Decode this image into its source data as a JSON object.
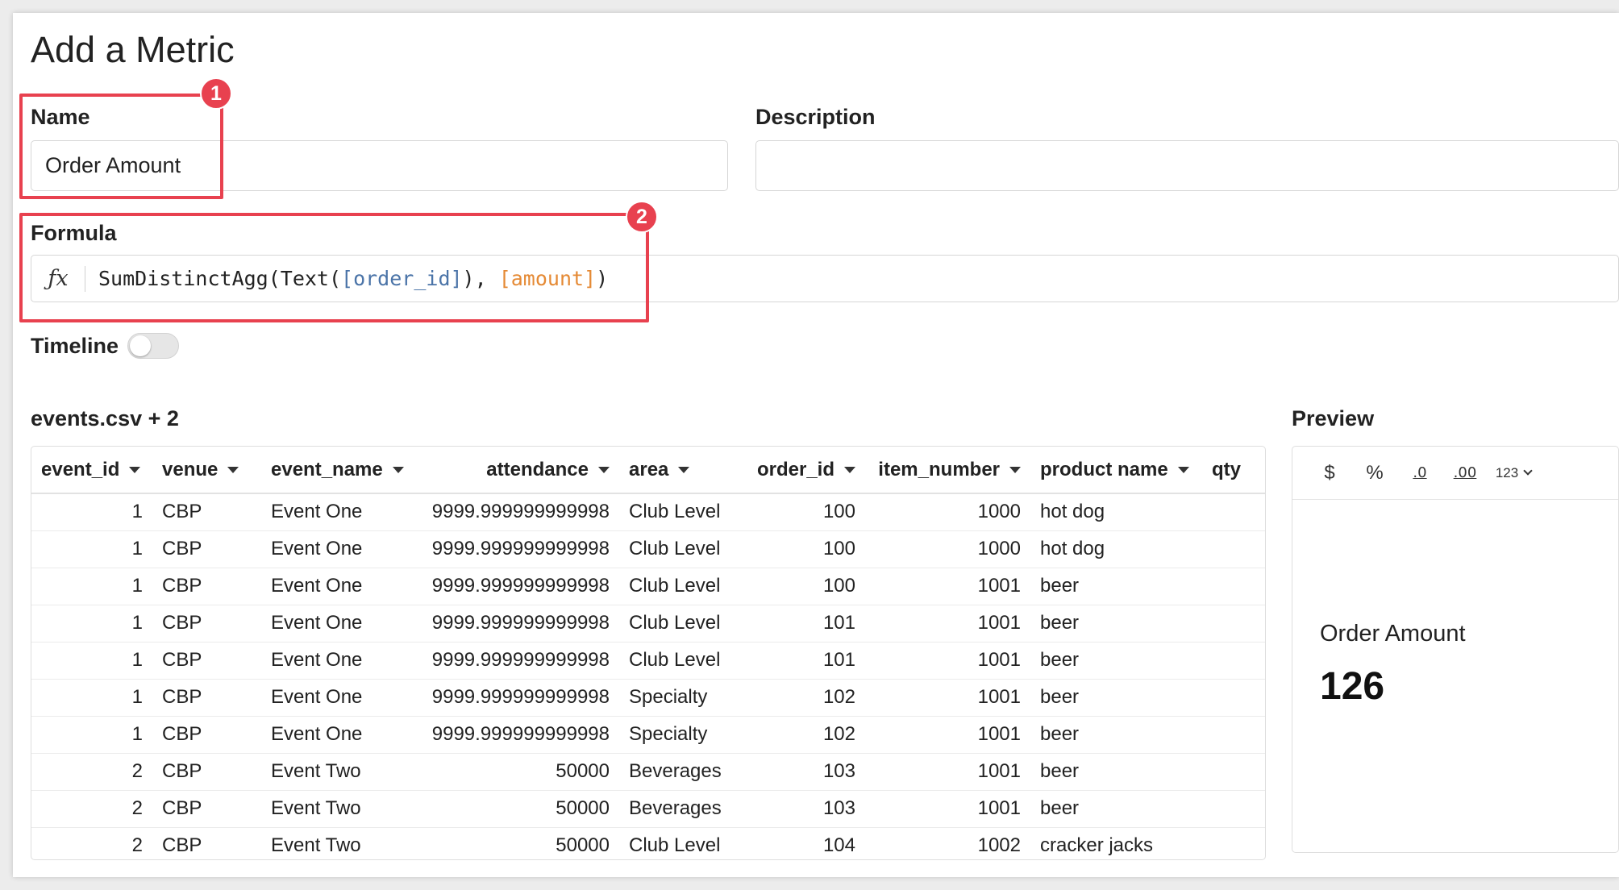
{
  "page": {
    "title": "Add a Metric"
  },
  "name_field": {
    "label": "Name",
    "value": "Order Amount",
    "badge": "1"
  },
  "description_field": {
    "label": "Description",
    "value": ""
  },
  "formula_field": {
    "label": "Formula",
    "badge": "2",
    "icon": "function-fx-icon",
    "parts": [
      "SumDistinctAgg(Text(",
      "[order_id]",
      "), ",
      "[amount]",
      ")"
    ]
  },
  "timeline": {
    "label": "Timeline",
    "enabled": false
  },
  "table": {
    "source_label": "events.csv + 2",
    "columns": [
      "event_id",
      "venue",
      "event_name",
      "attendance",
      "area",
      "order_id",
      "item_number",
      "product name",
      "qty"
    ],
    "rows": [
      [
        "1",
        "CBP",
        "Event One",
        "9999.999999999998",
        "Club Level",
        "100",
        "1000",
        "hot dog",
        ""
      ],
      [
        "1",
        "CBP",
        "Event One",
        "9999.999999999998",
        "Club Level",
        "100",
        "1000",
        "hot dog",
        ""
      ],
      [
        "1",
        "CBP",
        "Event One",
        "9999.999999999998",
        "Club Level",
        "100",
        "1001",
        "beer",
        ""
      ],
      [
        "1",
        "CBP",
        "Event One",
        "9999.999999999998",
        "Club Level",
        "101",
        "1001",
        "beer",
        ""
      ],
      [
        "1",
        "CBP",
        "Event One",
        "9999.999999999998",
        "Club Level",
        "101",
        "1001",
        "beer",
        ""
      ],
      [
        "1",
        "CBP",
        "Event One",
        "9999.999999999998",
        "Specialty",
        "102",
        "1001",
        "beer",
        ""
      ],
      [
        "1",
        "CBP",
        "Event One",
        "9999.999999999998",
        "Specialty",
        "102",
        "1001",
        "beer",
        ""
      ],
      [
        "2",
        "CBP",
        "Event Two",
        "50000",
        "Beverages",
        "103",
        "1001",
        "beer",
        ""
      ],
      [
        "2",
        "CBP",
        "Event Two",
        "50000",
        "Beverages",
        "103",
        "1001",
        "beer",
        ""
      ],
      [
        "2",
        "CBP",
        "Event Two",
        "50000",
        "Club Level",
        "104",
        "1002",
        "cracker jacks",
        ""
      ]
    ]
  },
  "preview": {
    "label": "Preview",
    "toolbar": [
      "$",
      "%",
      ".0",
      ".00",
      "123"
    ],
    "metric_title": "Order Amount",
    "metric_value": "126"
  },
  "colors": {
    "highlight": "#e8414f",
    "column_ref": "#4b74a8",
    "amount_ref": "#e58a35"
  }
}
